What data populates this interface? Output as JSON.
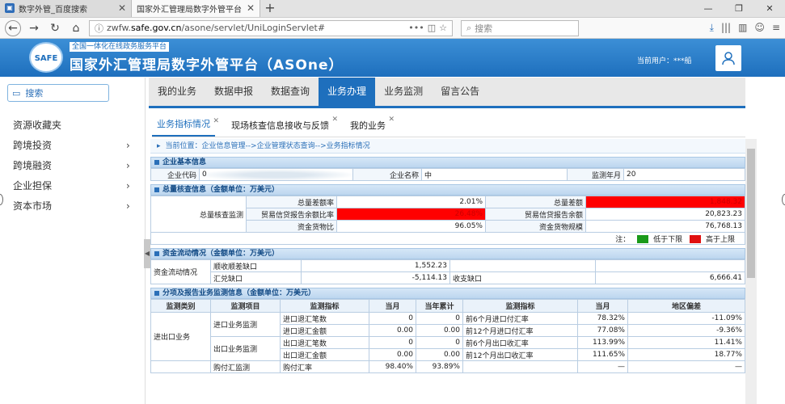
{
  "browser": {
    "tabs": [
      {
        "title": "数字外管_百度搜索"
      },
      {
        "title": "国家外汇管理局数字外管平台"
      }
    ],
    "url_prefix": "zwfw.",
    "url_domain": "safe.gov.cn",
    "url_path": "/asone/servlet/UniLoginServlet#",
    "url_dots": "•••",
    "search_placeholder": "搜索"
  },
  "header": {
    "logo_text": "SAFE",
    "slogan": "全国一体化在线政务服务平台",
    "title": "国家外汇管理局数字外管平台（ASOne）",
    "current_user": "当前用户：***船"
  },
  "sidebar": {
    "search_label": "搜索",
    "items": [
      {
        "label": "资源收藏夹",
        "has_arrow": false
      },
      {
        "label": "跨境投资",
        "has_arrow": true
      },
      {
        "label": "跨境融资",
        "has_arrow": true
      },
      {
        "label": "企业担保",
        "has_arrow": true
      },
      {
        "label": "资本市场",
        "has_arrow": true
      }
    ]
  },
  "menu": [
    "我的业务",
    "数据申报",
    "数据查询",
    "业务办理",
    "业务监测",
    "留言公告"
  ],
  "subtabs": [
    "业务指标情况",
    "现场核查信息接收与反馈",
    "我的业务"
  ],
  "breadcrumb": "当前位置：企业信息管理-->企业管理状态查询-->业务指标情况",
  "basic": {
    "section": "企业基本信息",
    "code_label": "企业代码",
    "code_value": "0",
    "name_label": "企业名称",
    "name_value": "中",
    "month_label": "监测年月",
    "month_value": "20"
  },
  "total": {
    "section": "总量核查信息（金额单位：万美元）",
    "group_label": "总量核查监测",
    "rows": [
      {
        "l1": "总量差额率",
        "v1": "2.01%",
        "l2": "总量差额",
        "v2": "1,848.32"
      },
      {
        "l1": "贸易信贷报告余额比率",
        "v1": "26.48%",
        "l2": "贸易信贷报告余额",
        "v2": "20,823.23"
      },
      {
        "l1": "资金货物比",
        "v1": "96.05%",
        "l2": "资金货物规模",
        "v2": "76,768.13"
      }
    ],
    "legend_note": "注：",
    "legend_low": "低于下限",
    "legend_high": "高于上限"
  },
  "flow": {
    "section": "资金流动情况（金额单位：万美元）",
    "group_label": "资金流动情况",
    "r1_label": "顺收顺差缺口",
    "r1_value": "1,552.23",
    "r2_label": "汇兑缺口",
    "r2_value": "-5,114.13",
    "r2_label2": "收支缺口",
    "r2_value2": "6,666.41"
  },
  "detail": {
    "section": "分项及报告业务监测信息（金额单位：万美元）",
    "headers": [
      "监测类别",
      "监测项目",
      "监测指标",
      "当月",
      "当年累计",
      "监测指标",
      "当月",
      "地区偏差"
    ],
    "category": "进出口业务",
    "rows": [
      {
        "item": "进口业务监测",
        "ind": "进口退汇笔数",
        "m": "0",
        "y": "0",
        "ind2": "前6个月进口付汇率",
        "m2": "78.32%",
        "dev": "-11.09%"
      },
      {
        "item": "",
        "ind": "进口退汇金额",
        "m": "0.00",
        "y": "0.00",
        "ind2": "前12个月进口付汇率",
        "m2": "77.08%",
        "dev": "-9.36%"
      },
      {
        "item": "出口业务监测",
        "ind": "出口退汇笔数",
        "m": "0",
        "y": "0",
        "ind2": "前6个月出口收汇率",
        "m2": "113.99%",
        "dev": "11.41%"
      },
      {
        "item": "",
        "ind": "出口退汇金额",
        "m": "0.00",
        "y": "0.00",
        "ind2": "前12个月出口收汇率",
        "m2": "111.65%",
        "dev": "18.77%"
      },
      {
        "item": "购付汇监测",
        "ind": "购付汇率",
        "m": "98.40%",
        "y": "93.89%",
        "ind2": "",
        "m2": "—",
        "dev": "—"
      }
    ]
  }
}
